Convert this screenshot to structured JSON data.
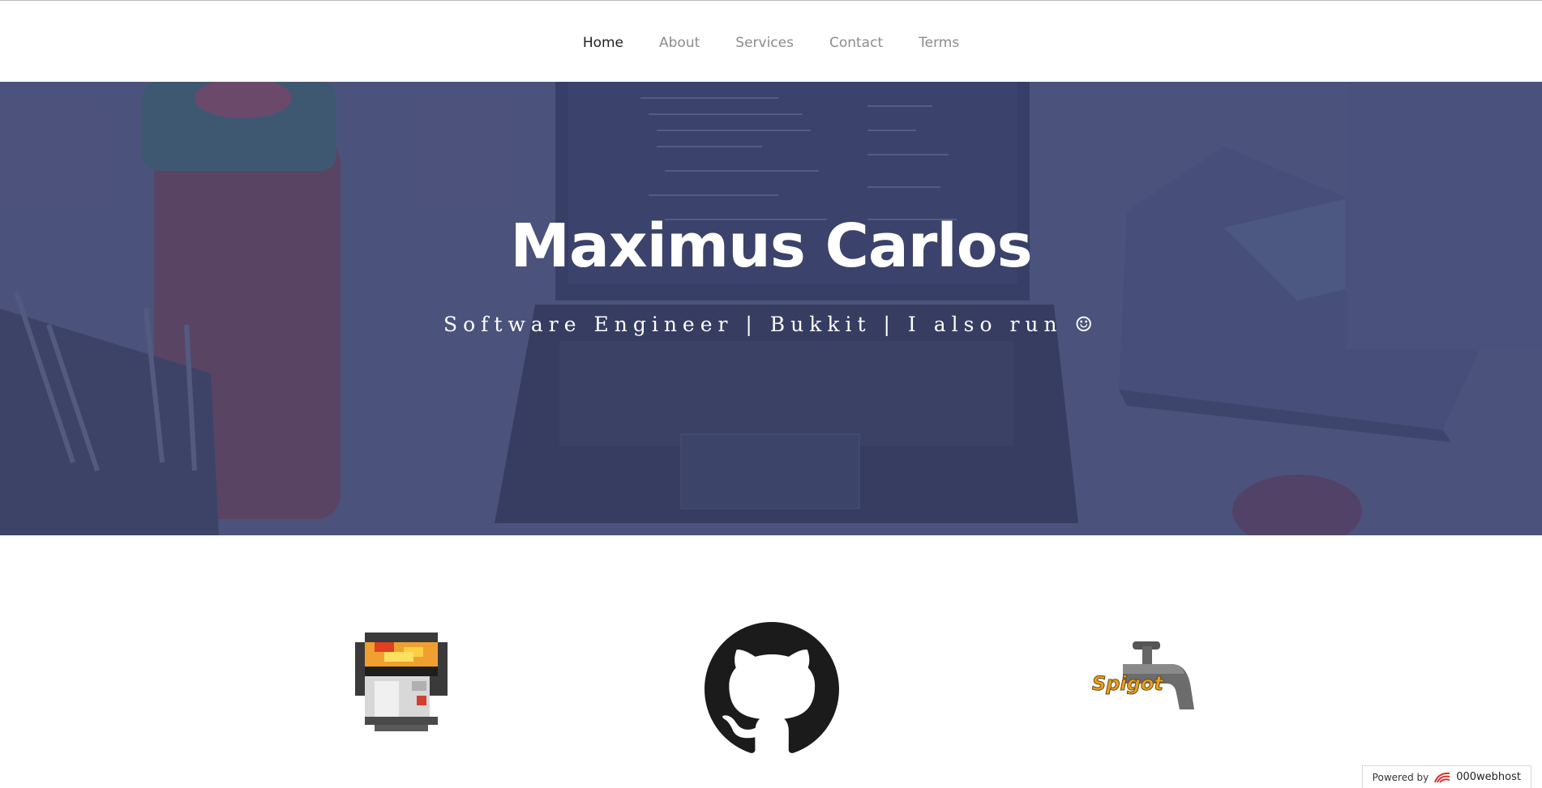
{
  "nav": {
    "items": [
      {
        "label": "Home",
        "active": true
      },
      {
        "label": "About",
        "active": false
      },
      {
        "label": "Services",
        "active": false
      },
      {
        "label": "Contact",
        "active": false
      },
      {
        "label": "Terms",
        "active": false
      }
    ]
  },
  "hero": {
    "title": "Maximus Carlos",
    "subtitle": "Software Engineer | Bukkit | I also run ☺"
  },
  "links": [
    {
      "icon": "bukkit-lava-bucket-icon"
    },
    {
      "icon": "github-icon"
    },
    {
      "icon": "spigot-icon",
      "logo_text": "Spigot"
    }
  ],
  "footer_badge": {
    "prefix": "Powered by",
    "brand": "000webhost",
    "icon": "000webhost-logo-icon"
  },
  "colors": {
    "hero_overlay": "#404878",
    "nav_active": "#222222",
    "nav_inactive": "#8c8c8c"
  }
}
